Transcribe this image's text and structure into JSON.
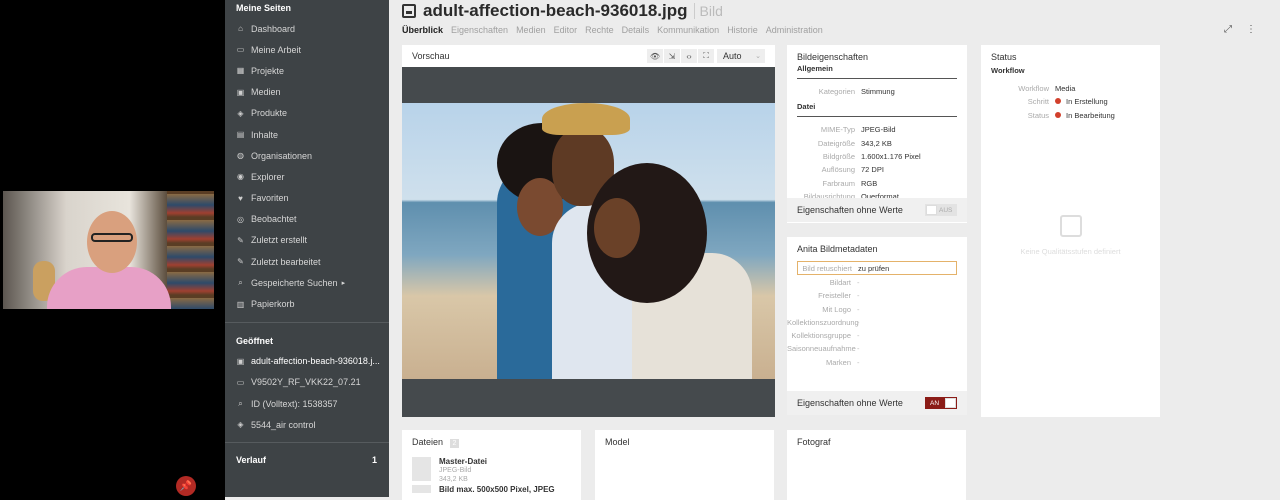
{
  "sidebar": {
    "heading": "Meine Seiten",
    "items": [
      {
        "label": "Dashboard",
        "icon": "home-icon"
      },
      {
        "label": "Meine Arbeit",
        "icon": "inbox-icon"
      },
      {
        "label": "Projekte",
        "icon": "project-icon"
      },
      {
        "label": "Medien",
        "icon": "media-icon"
      },
      {
        "label": "Produkte",
        "icon": "box-icon"
      },
      {
        "label": "Inhalte",
        "icon": "document-icon"
      },
      {
        "label": "Organisationen",
        "icon": "globe-icon"
      },
      {
        "label": "Explorer",
        "icon": "compass-icon"
      },
      {
        "label": "Favoriten",
        "icon": "heart-icon"
      },
      {
        "label": "Beobachtet",
        "icon": "eye-icon"
      },
      {
        "label": "Zuletzt erstellt",
        "icon": "edit-icon"
      },
      {
        "label": "Zuletzt bearbeitet",
        "icon": "edit-icon"
      },
      {
        "label": "Gespeicherte Suchen",
        "icon": "search-icon"
      },
      {
        "label": "Papierkorb",
        "icon": "trash-icon"
      }
    ],
    "opened_heading": "Geöffnet",
    "opened": [
      {
        "label": "adult-affection-beach-936018.j...",
        "icon": "image-icon"
      },
      {
        "label": "V9502Y_RF_VKK22_07.21",
        "icon": "card-icon"
      },
      {
        "label": "ID (Volltext): 1538357",
        "icon": "search-icon"
      },
      {
        "label": "5544_air control",
        "icon": "box-icon"
      }
    ],
    "history_label": "Verlauf",
    "history_count": "1"
  },
  "header": {
    "title": "adult-affection-beach-936018.jpg",
    "type": "Bild",
    "tabs": [
      "Überblick",
      "Eigenschaften",
      "Medien",
      "Editor",
      "Rechte",
      "Details",
      "Kommunikation",
      "Historie",
      "Administration"
    ]
  },
  "preview": {
    "title": "Vorschau",
    "zoom": "Auto"
  },
  "properties": {
    "title": "Bildeigenschaften",
    "general_heading": "Allgemein",
    "general": [
      {
        "k": "Kategorien",
        "v": "Stimmung"
      }
    ],
    "file_heading": "Datei",
    "file": [
      {
        "k": "MIME-Typ",
        "v": "JPEG-Bild"
      },
      {
        "k": "Dateigröße",
        "v": "343,2 KB"
      },
      {
        "k": "Bildgröße",
        "v": "1.600x1.176 Pixel"
      },
      {
        "k": "Auflösung",
        "v": "72 DPI"
      },
      {
        "k": "Farbraum",
        "v": "RGB"
      },
      {
        "k": "Bildausrichtung",
        "v": "Querformat"
      }
    ],
    "empty_label": "Eigenschaften ohne Werte",
    "empty_toggle": "AUS"
  },
  "anita": {
    "title": "Anita Bildmetadaten",
    "highlight": {
      "k": "Bild retuschiert",
      "v": "zu prüfen"
    },
    "fields": [
      {
        "k": "Bildart",
        "v": "-"
      },
      {
        "k": "Freisteller",
        "v": "-"
      },
      {
        "k": "Mit Logo",
        "v": "-"
      },
      {
        "k": "Kollektionszuordnung",
        "v": "-"
      },
      {
        "k": "Kollektionsgruppe",
        "v": "-"
      },
      {
        "k": "Saisonneuaufnahme",
        "v": "-"
      },
      {
        "k": "Marken",
        "v": "-"
      }
    ],
    "empty_label": "Eigenschaften ohne Werte",
    "empty_toggle": "AN"
  },
  "status": {
    "title": "Status",
    "workflow_heading": "Workflow",
    "rows": [
      {
        "k": "Workflow",
        "v": "Media",
        "dot": false
      },
      {
        "k": "Schritt",
        "v": "In Erstellung",
        "dot": true
      },
      {
        "k": "Status",
        "v": "In Bearbeitung",
        "dot": true
      }
    ],
    "quality_text": "Keine Qualitätsstufen definiert"
  },
  "files": {
    "title": "Dateien",
    "count": "2",
    "master_name": "Master-Datei",
    "master_type": "JPEG-Bild",
    "master_size": "343,2 KB",
    "second_name": "Bild max. 500x500 Pixel, JPEG"
  },
  "model": {
    "title": "Model"
  },
  "photographer": {
    "title": "Fotograf"
  }
}
